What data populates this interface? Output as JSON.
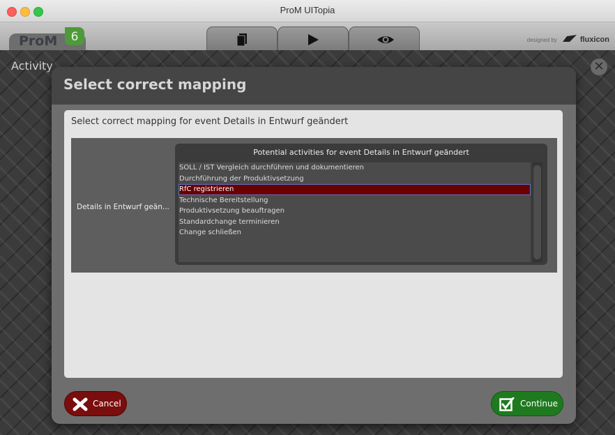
{
  "window": {
    "title": "ProM UITopia"
  },
  "header": {
    "logo_text": "ProM",
    "logo_version": "6",
    "designed_by": "designed by",
    "brand": "fluxicon",
    "tabs": [
      {
        "icon": "workspace-icon"
      },
      {
        "icon": "play-icon"
      },
      {
        "icon": "eye-icon"
      }
    ]
  },
  "background": {
    "activity_label": "Activity"
  },
  "dialog": {
    "title": "Select correct mapping",
    "prompt": "Select correct mapping for event Details in Entwurf geändert",
    "event_label": "Details in Entwurf geän...",
    "list_header": "Potential activities for event Details in Entwurf geändert",
    "activities": [
      "SOLL / IST Vergleich durchführen und dokumentieren",
      "Durchführung der Produktivsetzung",
      "RfC registrieren",
      "Technische Bereitstellung",
      "Produktivsetzung beauftragen",
      "Standardchange terminieren",
      "Change schließen"
    ],
    "selected_activity": "RfC registrieren",
    "cancel_label": "Cancel",
    "continue_label": "Continue"
  },
  "colors": {
    "cancel": "#7a0d0d",
    "continue": "#1f7a1f",
    "selection": "#6a0000",
    "logo_green": "#4e9a3a"
  }
}
